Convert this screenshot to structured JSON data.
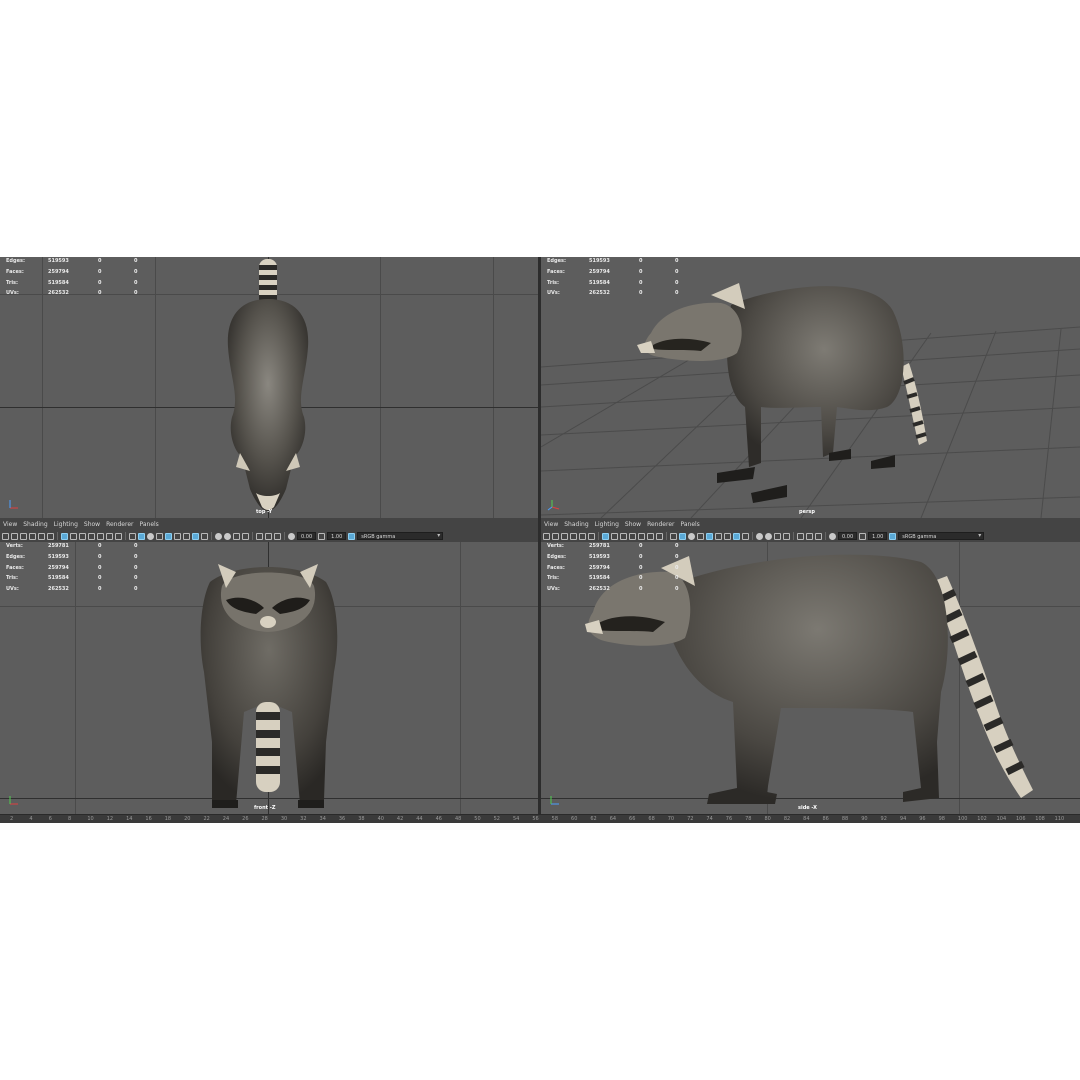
{
  "panel_menu": [
    "View",
    "Shading",
    "Lighting",
    "Show",
    "Renderer",
    "Panels"
  ],
  "toolbar": {
    "exposure": "0.00",
    "gamma": "1.00",
    "color_space": "sRGB gamma"
  },
  "hud": {
    "labels": {
      "verts": "Verts:",
      "edges": "Edges:",
      "faces": "Faces:",
      "tris": "Tris:",
      "uvs": "UVs:"
    },
    "values": {
      "verts": [
        "259781",
        "0",
        "0"
      ],
      "edges": [
        "519593",
        "0",
        "0"
      ],
      "faces": [
        "259794",
        "0",
        "0"
      ],
      "tris": [
        "519584",
        "0",
        "0"
      ],
      "uvs": [
        "262532",
        "0",
        "0"
      ]
    }
  },
  "viewports": {
    "top": {
      "camera": "top -Y"
    },
    "persp": {
      "camera": "persp"
    },
    "front": {
      "camera": "front -Z"
    },
    "side": {
      "camera": "side -X"
    }
  },
  "timeline_ticks": [
    "2",
    "4",
    "6",
    "8",
    "10",
    "12",
    "14",
    "16",
    "18",
    "20",
    "22",
    "24",
    "26",
    "28",
    "30",
    "32",
    "34",
    "36",
    "38",
    "40",
    "42",
    "44",
    "46",
    "48",
    "50",
    "52",
    "54",
    "56",
    "58",
    "60",
    "62",
    "64",
    "66",
    "68",
    "70",
    "72",
    "74",
    "76",
    "78",
    "80",
    "82",
    "84",
    "86",
    "88",
    "90",
    "92",
    "94",
    "96",
    "98",
    "100",
    "102",
    "104",
    "106",
    "108",
    "110"
  ],
  "colors": {
    "viewport_bg": "#5d5d5d",
    "panel_bg": "#444444",
    "selected_tool": "#5aa9d6",
    "fur": "#4a4844"
  }
}
